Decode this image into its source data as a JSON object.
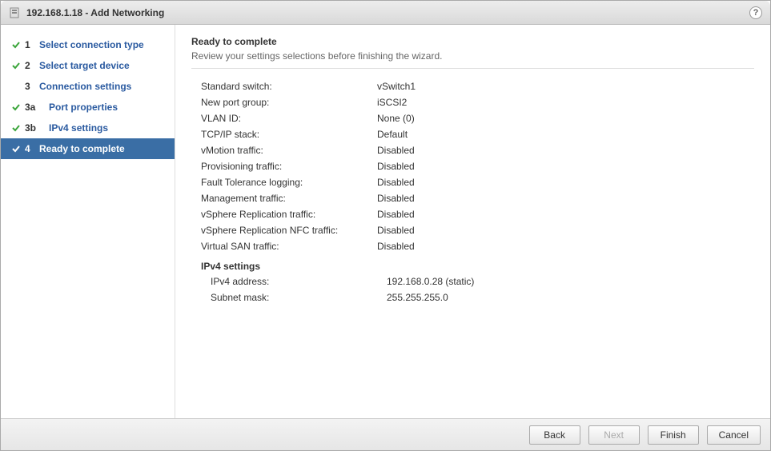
{
  "title": "192.168.1.18 - Add Networking",
  "help_tooltip": "Help",
  "sidebar": {
    "steps": [
      {
        "num": "1",
        "label": "Select connection type",
        "checked": true,
        "active": false,
        "sub": false
      },
      {
        "num": "2",
        "label": "Select target device",
        "checked": true,
        "active": false,
        "sub": false
      },
      {
        "num": "3",
        "label": "Connection settings",
        "checked": false,
        "active": false,
        "sub": false
      },
      {
        "num": "3a",
        "label": "Port properties",
        "checked": true,
        "active": false,
        "sub": true
      },
      {
        "num": "3b",
        "label": "IPv4 settings",
        "checked": true,
        "active": false,
        "sub": true
      },
      {
        "num": "4",
        "label": "Ready to complete",
        "checked": true,
        "active": true,
        "sub": false
      }
    ]
  },
  "main": {
    "title": "Ready to complete",
    "subtitle": "Review your settings selections before finishing the wizard.",
    "rows": [
      {
        "key": "Standard switch:",
        "val": "vSwitch1"
      },
      {
        "key": "New port group:",
        "val": "iSCSI2"
      },
      {
        "key": "VLAN ID:",
        "val": "None (0)"
      },
      {
        "key": "TCP/IP stack:",
        "val": "Default"
      },
      {
        "key": "vMotion traffic:",
        "val": "Disabled"
      },
      {
        "key": "Provisioning traffic:",
        "val": "Disabled"
      },
      {
        "key": "Fault Tolerance logging:",
        "val": "Disabled"
      },
      {
        "key": "Management traffic:",
        "val": "Disabled"
      },
      {
        "key": "vSphere Replication traffic:",
        "val": "Disabled"
      },
      {
        "key": "vSphere Replication NFC traffic:",
        "val": "Disabled"
      },
      {
        "key": "Virtual SAN traffic:",
        "val": "Disabled"
      }
    ],
    "ipv4_section": "IPv4 settings",
    "ipv4_rows": [
      {
        "key": "IPv4 address:",
        "val": "192.168.0.28 (static)"
      },
      {
        "key": "Subnet mask:",
        "val": "255.255.255.0"
      }
    ]
  },
  "buttons": {
    "back": "Back",
    "next": "Next",
    "finish": "Finish",
    "cancel": "Cancel"
  }
}
